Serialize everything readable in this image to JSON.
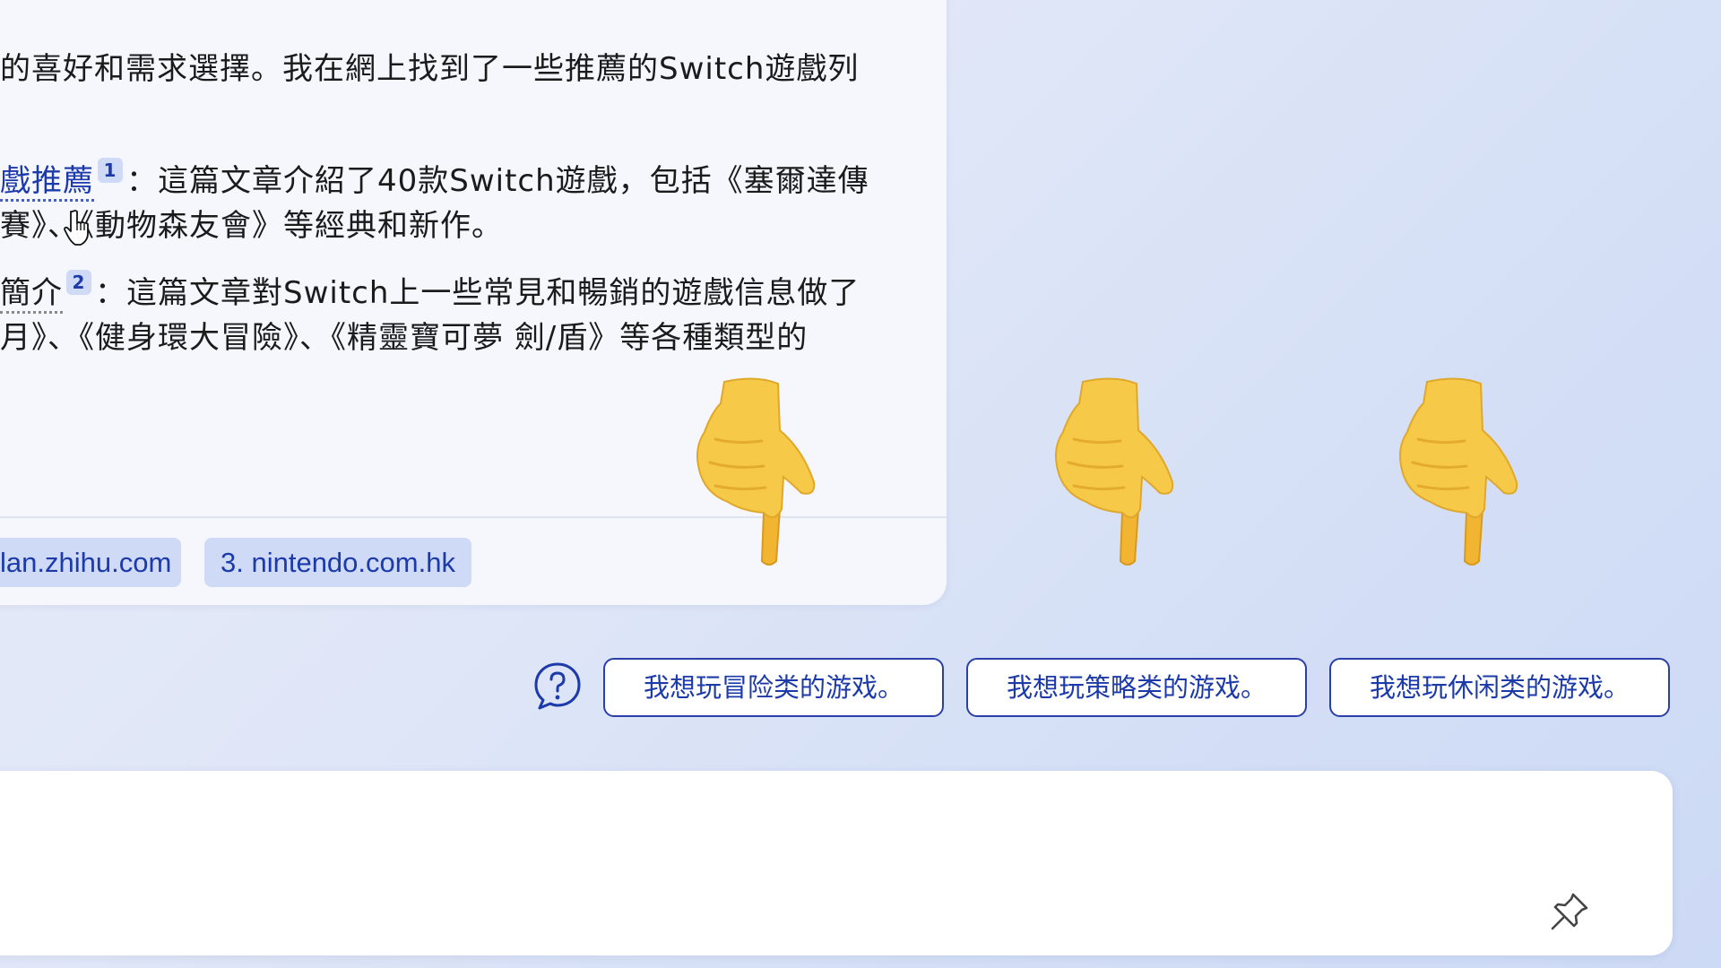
{
  "answer": {
    "line1": "的喜好和需求選擇。我在網上找到了一些推薦的Switch遊戲列",
    "item1": {
      "link_text": "戲推薦",
      "cite_number": "1",
      "description_start": "：這篇文章介紹了40款Switch遊戲，包括《塞爾達傳",
      "description_end": "賽》、《動物森友會》等經典和新作。"
    },
    "item2": {
      "link_text": "簡介",
      "cite_number": "2",
      "description_start": "：這篇文章對Switch上一些常見和暢銷的遊戲信息做了",
      "description_end": "月》、《健身環大冒險》、《精靈寶可夢 劍/盾》等各種類型的"
    }
  },
  "sources": [
    {
      "label": "lan.zhihu.com"
    },
    {
      "label": "3. nintendo.com.hk"
    }
  ],
  "suggestions": [
    {
      "label": "我想玩冒险类的游戏。"
    },
    {
      "label": "我想玩策略类的游戏。"
    },
    {
      "label": "我想玩休闲类的游戏。"
    }
  ],
  "input": {
    "value": "",
    "placeholder": ""
  },
  "colors": {
    "accent": "#1c3aa9",
    "chip_background": "#cfdaf7",
    "card_background": "#f5f7fd",
    "emoji_yellow": "#f7c948"
  },
  "icons": {
    "pointer": "backhand-index-pointing-down-icon",
    "help": "question-bubble-icon",
    "pin": "pin-icon",
    "cursor": "hand-cursor-icon"
  }
}
